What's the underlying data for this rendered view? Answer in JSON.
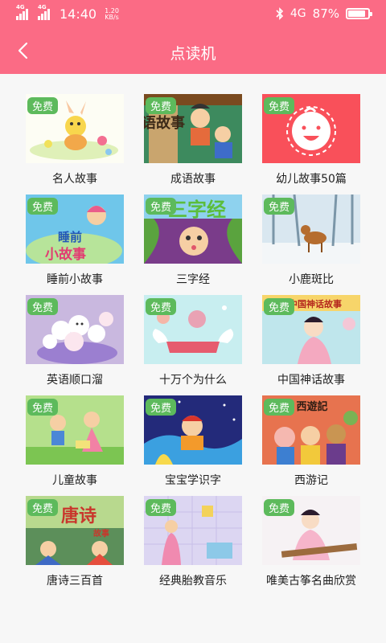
{
  "status_bar": {
    "network_1": "4G",
    "network_2": "4G",
    "time": "14:40",
    "speed_value": "1.20",
    "speed_unit": "KB/s",
    "right_network": "4G",
    "battery": "87%"
  },
  "header": {
    "title": "点读机"
  },
  "items": [
    {
      "tag": "免费",
      "label": "名人故事"
    },
    {
      "tag": "免费",
      "label": "成语故事"
    },
    {
      "tag": "免费",
      "label": "幼儿故事50篇"
    },
    {
      "tag": "免费",
      "label": "睡前小故事"
    },
    {
      "tag": "免费",
      "label": "三字经"
    },
    {
      "tag": "免费",
      "label": "小鹿斑比"
    },
    {
      "tag": "免费",
      "label": "英语顺口溜"
    },
    {
      "tag": "免费",
      "label": "十万个为什么"
    },
    {
      "tag": "免费",
      "label": "中国神话故事"
    },
    {
      "tag": "免费",
      "label": "儿童故事"
    },
    {
      "tag": "免费",
      "label": "宝宝学识字"
    },
    {
      "tag": "免费",
      "label": "西游记"
    },
    {
      "tag": "免费",
      "label": "唐诗三百首"
    },
    {
      "tag": "免费",
      "label": "经典胎教音乐"
    },
    {
      "tag": "免费",
      "label": "唯美古筝名曲欣赏"
    }
  ],
  "thumb_text": {
    "chengyu": "语故事",
    "shuiqian_1": "睡前",
    "shuiqian_2": "小故事",
    "sanzijing": "三字经",
    "shenhua": "中国神话故事",
    "xiyou": "西遊記",
    "tangshi": "唐诗",
    "tangshi_sub": "故事"
  },
  "colors": {
    "header": "#fb6b85",
    "tag": "#5dba5c"
  }
}
